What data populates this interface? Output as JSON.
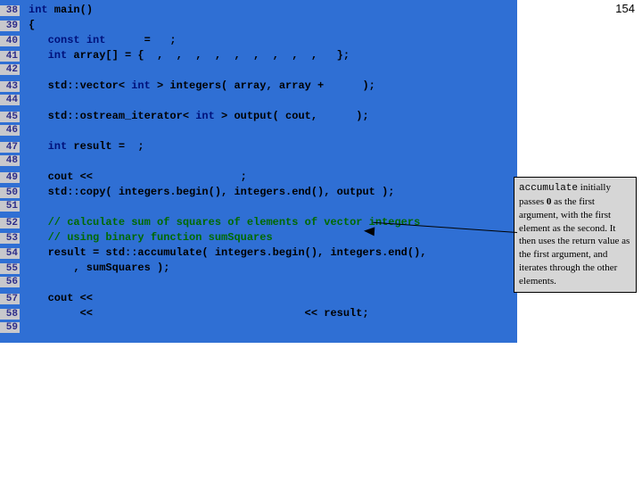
{
  "page_number": "154",
  "lines": [
    {
      "n": "38",
      "segs": [
        {
          "t": "int",
          "c": "kw"
        },
        {
          "t": " main()",
          "c": "code"
        }
      ]
    },
    {
      "n": "39",
      "segs": [
        {
          "t": "{",
          "c": "code"
        }
      ]
    },
    {
      "n": "40",
      "segs": [
        {
          "t": "   ",
          "c": "code"
        },
        {
          "t": "const int",
          "c": "kw"
        },
        {
          "t": "      =   ;",
          "c": "code"
        }
      ]
    },
    {
      "n": "41",
      "segs": [
        {
          "t": "   ",
          "c": "code"
        },
        {
          "t": "int",
          "c": "kw"
        },
        {
          "t": " array[] = {  ,  ,  ,  ,  ,  ,  ,  ,  ,   };",
          "c": "code"
        }
      ]
    },
    {
      "n": "42",
      "segs": []
    },
    {
      "n": "43",
      "segs": [
        {
          "t": "   std::vector< ",
          "c": "code"
        },
        {
          "t": "int",
          "c": "kw"
        },
        {
          "t": " > integers( array, array +      );",
          "c": "code"
        }
      ]
    },
    {
      "n": "44",
      "segs": []
    },
    {
      "n": "45",
      "segs": [
        {
          "t": "   std::ostream_iterator< ",
          "c": "code"
        },
        {
          "t": "int",
          "c": "kw"
        },
        {
          "t": " > output( cout,      );",
          "c": "code"
        }
      ]
    },
    {
      "n": "46",
      "segs": []
    },
    {
      "n": "47",
      "segs": [
        {
          "t": "   ",
          "c": "code"
        },
        {
          "t": "int",
          "c": "kw"
        },
        {
          "t": " result =  ;",
          "c": "code"
        }
      ]
    },
    {
      "n": "48",
      "segs": []
    },
    {
      "n": "49",
      "segs": [
        {
          "t": "   cout <<                       ;",
          "c": "code"
        }
      ]
    },
    {
      "n": "50",
      "segs": [
        {
          "t": "   std::copy( integers.begin(), integers.end(), output );",
          "c": "code"
        }
      ]
    },
    {
      "n": "51",
      "segs": []
    },
    {
      "n": "52",
      "segs": [
        {
          "t": "   ",
          "c": "code"
        },
        {
          "t": "// calculate sum of squares of elements of vector integers",
          "c": "cm"
        }
      ]
    },
    {
      "n": "53",
      "segs": [
        {
          "t": "   ",
          "c": "code"
        },
        {
          "t": "// using binary function sumSquares",
          "c": "cm"
        }
      ]
    },
    {
      "n": "54",
      "segs": [
        {
          "t": "   result = std::accumulate( integers.begin(), integers.end(),",
          "c": "code"
        }
      ]
    },
    {
      "n": "55",
      "segs": [
        {
          "t": "       , sumSquares );",
          "c": "code"
        }
      ]
    },
    {
      "n": "56",
      "segs": []
    },
    {
      "n": "57",
      "segs": [
        {
          "t": "   cout <<",
          "c": "code"
        }
      ]
    },
    {
      "n": "58",
      "segs": [
        {
          "t": "        <<                                 << result;",
          "c": "code"
        }
      ]
    },
    {
      "n": "59",
      "segs": []
    }
  ],
  "callout": {
    "mono": "accumulate",
    "rest1": " initially passes ",
    "bold": "0",
    "rest2": " as the first argument, with the first element as the second. It then uses the return value as the first argument, and iterates through the other elements."
  }
}
